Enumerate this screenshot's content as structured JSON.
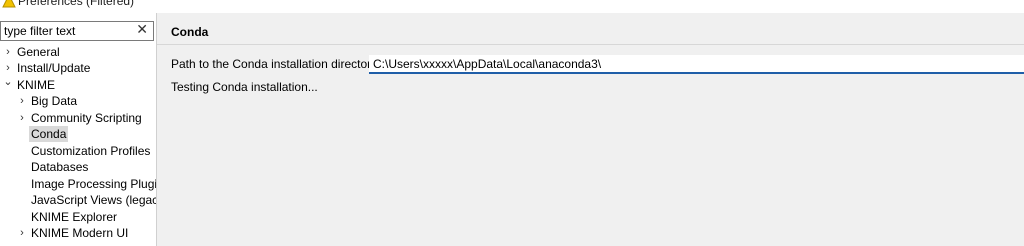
{
  "window": {
    "title": "Preferences (Filtered)"
  },
  "filter": {
    "placeholder": "type filter text",
    "clear_glyph": "✕"
  },
  "tree": [
    {
      "label": "General",
      "arrow": "›"
    },
    {
      "label": "Install/Update",
      "arrow": "›"
    },
    {
      "label": "KNIME",
      "arrow": "⌄"
    },
    {
      "label": "Big Data",
      "arrow": "›"
    },
    {
      "label": "Community Scripting",
      "arrow": "›"
    },
    {
      "label": "Conda",
      "arrow": ""
    },
    {
      "label": "Customization Profiles",
      "arrow": ""
    },
    {
      "label": "Databases",
      "arrow": ""
    },
    {
      "label": "Image Processing Plugin",
      "arrow": ""
    },
    {
      "label": "JavaScript Views (legacy)",
      "arrow": ""
    },
    {
      "label": "KNIME Explorer",
      "arrow": ""
    },
    {
      "label": "KNIME Modern UI",
      "arrow": "›"
    }
  ],
  "page": {
    "title": "Conda",
    "path_label": "Path to the Conda installation directory",
    "path_value": "C:\\Users\\xxxxx\\AppData\\Local\\anaconda3\\",
    "status": "Testing Conda installation..."
  },
  "icons": {
    "title_icon": "warning-icon"
  }
}
